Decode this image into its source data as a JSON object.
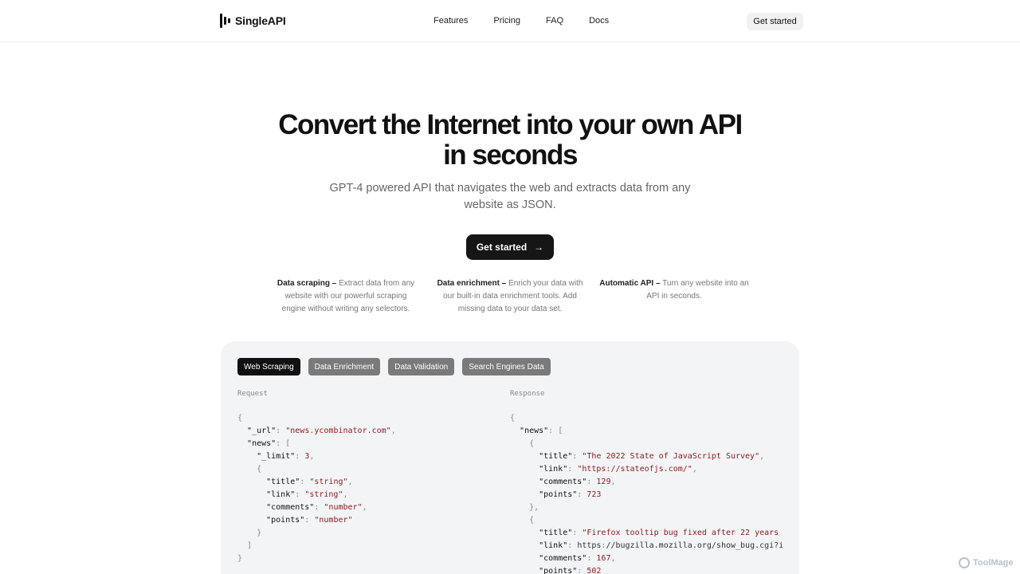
{
  "brand": {
    "name": "SingleAPI"
  },
  "nav": {
    "items": [
      "Features",
      "Pricing",
      "FAQ",
      "Docs"
    ],
    "cta": "Get started"
  },
  "hero": {
    "title": "Convert the Internet into your own API in seconds",
    "subtitle": "GPT-4 powered API that navigates the web and extracts data from any website as JSON.",
    "cta": "Get started"
  },
  "features": [
    {
      "title": "Data scraping –",
      "text": "Extract data from any website with our powerful scraping engine without writing any selectors."
    },
    {
      "title": "Data enrichment –",
      "text": "Enrich your data with our built-in data enrichment tools. Add missing data to your data set."
    },
    {
      "title": "Automatic API –",
      "text": "Turn any website into an API in seconds."
    }
  ],
  "tabs": [
    "Web Scraping",
    "Data Enrichment",
    "Data Validation",
    "Search Engines Data"
  ],
  "active_tab": "Web Scraping",
  "request": {
    "label": "Request",
    "lines": [
      "{",
      "  \"_url\": \"news.ycombinator.com\",",
      "  \"news\": [",
      "    \"_limit\": 3,",
      "    {",
      "      \"title\": \"string\",",
      "      \"link\": \"string\",",
      "      \"comments\": \"number\",",
      "      \"points\": \"number\"",
      "    }",
      "  ]",
      "}"
    ]
  },
  "response": {
    "label": "Response",
    "lines": [
      "{",
      "  \"news\": [",
      "    {",
      "      \"title\": \"The 2022 State of JavaScript Survey\",",
      "      \"link\": \"https://stateofjs.com/\",",
      "      \"comments\": 129,",
      "      \"points\": 723",
      "    },",
      "    {",
      "      \"title\": \"Firefox tooltip bug fixed after 22 years \"",
      "      \"link\": \"https://bugzilla.mozilla.org/show_bug.cgi?i",
      "      \"comments\": 167,",
      "      \"points\": 502"
    ]
  },
  "watermark": "ToolMage",
  "colors": {
    "accent": "#111111",
    "panel": "#f3f4f6",
    "string": "#8a1c1c"
  }
}
